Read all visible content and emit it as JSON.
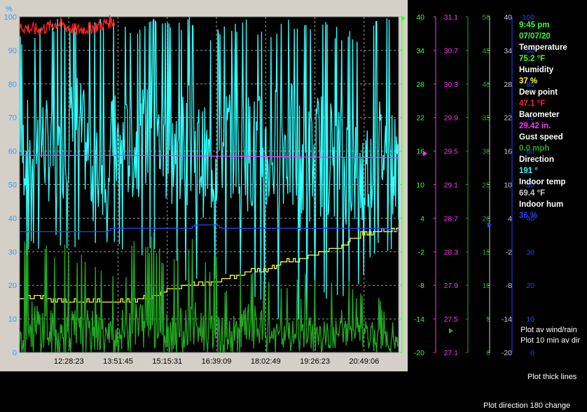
{
  "title": "",
  "readings": {
    "time": "9:45 pm",
    "date": "07/07/20",
    "items": [
      {
        "label": "Temperature",
        "value": "75.2 °F",
        "color": "#33ff33"
      },
      {
        "label": "Humidity",
        "value": "37 %",
        "color": "#ffff33"
      },
      {
        "label": "Dew point",
        "value": "47.1 °F",
        "color": "#ff2222"
      },
      {
        "label": "Barometer",
        "value": "29.42 in.",
        "color": "#ff33ff"
      },
      {
        "label": "Gust speed",
        "value": "0.0 mph",
        "color": "#22aa22"
      },
      {
        "label": "Direction",
        "value": "191 °",
        "color": "#33ffff"
      },
      {
        "label": "Indoor temp",
        "value": "69.4 °F",
        "color": "#cccccc"
      },
      {
        "label": "Indoor hum",
        "value": "36 %",
        "color": "#2244ff"
      }
    ]
  },
  "options": {
    "plot_av_wind_rain": "Plot av wind/rain",
    "plot_10_min_av_dir": "Plot 10 min av dir",
    "plot_thick_lines": "Plot thick lines",
    "plot_direction_180": "Plot direction 180 change"
  },
  "chart_data": {
    "type": "line",
    "grid": true,
    "background": "#000000",
    "x_tick_labels": [
      "12:28:23",
      "13:51:45",
      "15:15:31",
      "16:39:09",
      "18:02:49",
      "19:26:23",
      "20:49:06"
    ],
    "axes": {
      "percent": {
        "label": "%",
        "ticks": [
          0,
          10,
          20,
          30,
          40,
          50,
          60,
          70,
          80,
          90,
          100
        ],
        "color": "#3399ff"
      },
      "temperature": {
        "ticks": [
          -20,
          -14,
          -8,
          -2,
          4,
          10,
          16,
          22,
          28,
          34,
          40
        ],
        "color": "#33ff33"
      },
      "barometer": {
        "ticks": [
          27.1,
          27.5,
          27.9,
          28.3,
          28.7,
          29.1,
          29.5,
          29.9,
          30.3,
          30.7,
          31.1
        ],
        "color": "#ff33ff"
      },
      "wind": {
        "ticks": [
          0,
          5,
          10,
          15,
          20,
          25,
          30,
          35,
          40,
          45,
          50
        ],
        "color": "#22aa22"
      },
      "indoor_temp": {
        "ticks": [
          -20,
          -14,
          -8,
          -2,
          4,
          10,
          16,
          22,
          28,
          34,
          40
        ],
        "color": "#cccccc"
      },
      "indoor_hum": {
        "ticks": [
          0,
          10,
          20,
          30,
          40,
          50,
          60,
          70,
          80,
          90,
          100
        ],
        "color": "#2244ff"
      }
    },
    "series": [
      {
        "color": "#33ffff",
        "axis": "percent",
        "x": [
          0,
          0.05,
          0.1,
          0.15,
          0.2,
          0.25,
          0.3,
          0.35,
          0.4,
          0.45,
          0.5,
          0.55,
          0.6,
          0.65,
          0.7,
          0.75,
          0.8,
          0.85,
          0.9,
          0.95,
          1.0
        ],
        "values": [
          58,
          65,
          55,
          70,
          52,
          62,
          60,
          66,
          58,
          62,
          55,
          64,
          60,
          58,
          63,
          55,
          60,
          57,
          52,
          61,
          55
        ],
        "min": [
          28,
          30,
          32,
          30,
          30,
          30,
          28,
          30,
          26,
          20,
          22,
          20,
          20,
          10,
          10,
          8,
          14,
          14,
          20,
          30,
          30
        ],
        "max": [
          95,
          98,
          100,
          98,
          100,
          100,
          96,
          100,
          100,
          100,
          96,
          98,
          100,
          96,
          100,
          100,
          100,
          96,
          96,
          100,
          100
        ]
      },
      {
        "color": "#ffff33",
        "axis": "percent",
        "x": [
          0,
          0.05,
          0.1,
          0.15,
          0.2,
          0.25,
          0.3,
          0.35,
          0.4,
          0.45,
          0.5,
          0.55,
          0.6,
          0.65,
          0.7,
          0.75,
          0.8,
          0.85,
          0.9,
          0.95,
          1.0
        ],
        "values": [
          16,
          16.5,
          15.5,
          15,
          15,
          15,
          15.5,
          17,
          19,
          20.5,
          21,
          22,
          24,
          25,
          27,
          28,
          30,
          32,
          35,
          36,
          37
        ]
      },
      {
        "color": "#ff2222",
        "axis": "percent",
        "x": [
          0,
          0.05,
          0.1,
          0.15,
          0.2,
          0.25
        ],
        "values": [
          97,
          96,
          98,
          96,
          97,
          99
        ]
      },
      {
        "color": "#ff33ff",
        "axis": "barometer",
        "x": [
          0,
          0.25,
          0.5,
          0.75,
          1.0
        ],
        "values": [
          29.45,
          29.45,
          29.44,
          29.43,
          29.42
        ]
      },
      {
        "color": "#2244ff",
        "axis": "indoor_hum",
        "x": [
          0,
          0.23,
          0.24,
          0.45,
          0.46,
          0.52,
          0.53,
          0.96,
          1.0
        ],
        "values": [
          36,
          36,
          37,
          37,
          38,
          38,
          37,
          37,
          36
        ]
      },
      {
        "color": "#22aa22",
        "axis": "wind",
        "x": [
          0,
          0.05,
          0.1,
          0.15,
          0.2,
          0.25,
          0.3,
          0.35,
          0.4,
          0.45,
          0.5,
          0.55,
          0.6,
          0.65,
          0.7,
          0.75,
          0.8,
          0.85,
          0.9,
          0.95,
          1.0
        ],
        "values": [
          3,
          4,
          2,
          3,
          3,
          2,
          5,
          4,
          3,
          4,
          3,
          2,
          4,
          3,
          2,
          3,
          2,
          3,
          3,
          2,
          1
        ],
        "min": [
          0,
          0,
          0,
          0,
          0,
          0,
          0,
          0,
          0,
          0,
          0,
          0,
          0,
          0,
          0,
          0,
          0,
          0,
          0,
          0,
          0
        ],
        "max": [
          20,
          18,
          16,
          17,
          14,
          12,
          17,
          18,
          16,
          18,
          16,
          12,
          16,
          14,
          10,
          12,
          12,
          10,
          12,
          8,
          6
        ]
      }
    ]
  }
}
